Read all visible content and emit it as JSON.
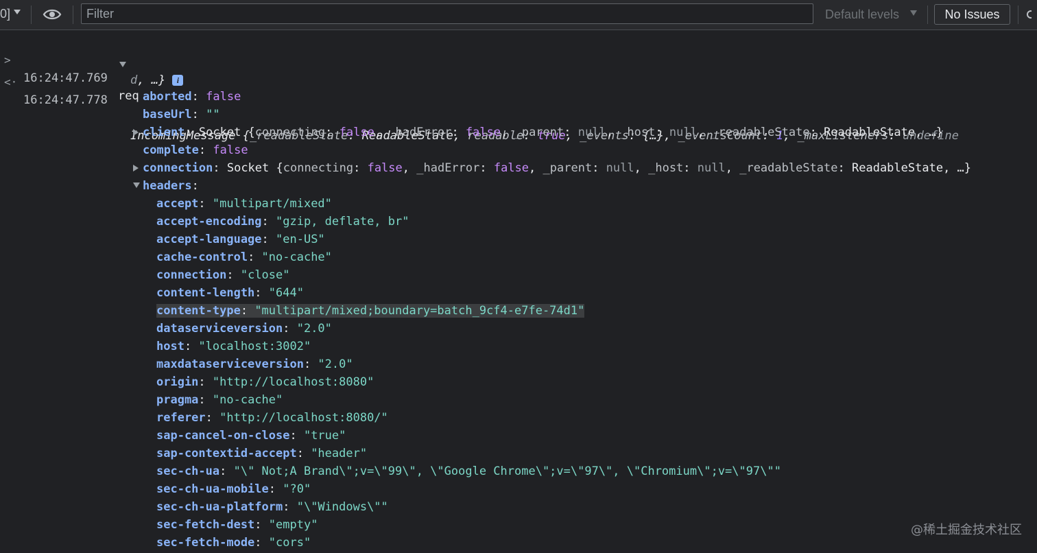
{
  "toolbar": {
    "context_fragment": "0]",
    "filter_placeholder": "Filter",
    "levels_label": "Default levels",
    "issues_label": "No Issues"
  },
  "log": {
    "input_ts": "16:24:47.769",
    "input_text": "req",
    "output_ts": "16:24:47.778",
    "preview_class": "IncomingMessage",
    "preview_props": [
      {
        "k": "_readableState",
        "v": "ReadableState",
        "t": "cls"
      },
      {
        "k": "readable",
        "v": "true",
        "t": "bool"
      },
      {
        "k": "_events",
        "v": "{…}",
        "t": "pun"
      },
      {
        "k": "_eventsCount",
        "v": "1",
        "t": "num"
      },
      {
        "k": "_maxListeners",
        "v": "undefine",
        "t": "und"
      }
    ],
    "preview_wrap": "d",
    "preview_ellipsis": "…}",
    "info_icon": "i"
  },
  "props": {
    "aborted": {
      "k": "aborted",
      "v": "false"
    },
    "baseUrl": {
      "k": "baseUrl",
      "v": "\"\""
    },
    "client": {
      "k": "client",
      "cls": "Socket",
      "summary": [
        {
          "k": "connecting",
          "v": "false",
          "t": "bool"
        },
        {
          "k": "_hadError",
          "v": "false",
          "t": "bool"
        },
        {
          "k": "_parent",
          "v": "null",
          "t": "nul"
        },
        {
          "k": "_host",
          "v": "null",
          "t": "nul"
        },
        {
          "k": "_readableState",
          "v": "ReadableState",
          "t": "cls"
        }
      ]
    },
    "complete": {
      "k": "complete",
      "v": "false"
    },
    "connection": {
      "k": "connection",
      "cls": "Socket",
      "summary": [
        {
          "k": "connecting",
          "v": "false",
          "t": "bool"
        },
        {
          "k": "_hadError",
          "v": "false",
          "t": "bool"
        },
        {
          "k": "_parent",
          "v": "null",
          "t": "nul"
        },
        {
          "k": "_host",
          "v": "null",
          "t": "nul"
        },
        {
          "k": "_readableState",
          "v": "ReadableState",
          "t": "cls"
        }
      ]
    },
    "headers": {
      "k": "headers"
    }
  },
  "headers": [
    {
      "k": "accept",
      "v": "\"multipart/mixed\""
    },
    {
      "k": "accept-encoding",
      "v": "\"gzip, deflate, br\""
    },
    {
      "k": "accept-language",
      "v": "\"en-US\""
    },
    {
      "k": "cache-control",
      "v": "\"no-cache\""
    },
    {
      "k": "connection",
      "v": "\"close\""
    },
    {
      "k": "content-length",
      "v": "\"644\""
    },
    {
      "k": "content-type",
      "v": "\"multipart/mixed;boundary=batch_9cf4-e7fe-74d1\"",
      "highlight": true
    },
    {
      "k": "dataserviceversion",
      "v": "\"2.0\""
    },
    {
      "k": "host",
      "v": "\"localhost:3002\""
    },
    {
      "k": "maxdataserviceversion",
      "v": "\"2.0\""
    },
    {
      "k": "origin",
      "v": "\"http://localhost:8080\""
    },
    {
      "k": "pragma",
      "v": "\"no-cache\""
    },
    {
      "k": "referer",
      "v": "\"http://localhost:8080/\""
    },
    {
      "k": "sap-cancel-on-close",
      "v": "\"true\""
    },
    {
      "k": "sap-contextid-accept",
      "v": "\"header\""
    },
    {
      "k": "sec-ch-ua",
      "v": "\"\\\" Not;A Brand\\\";v=\\\"99\\\", \\\"Google Chrome\\\";v=\\\"97\\\", \\\"Chromium\\\";v=\\\"97\\\"\""
    },
    {
      "k": "sec-ch-ua-mobile",
      "v": "\"?0\""
    },
    {
      "k": "sec-ch-ua-platform",
      "v": "\"\\\"Windows\\\"\""
    },
    {
      "k": "sec-fetch-dest",
      "v": "\"empty\""
    },
    {
      "k": "sec-fetch-mode",
      "v": "\"cors\""
    }
  ],
  "watermark": "@稀土掘金技术社区"
}
